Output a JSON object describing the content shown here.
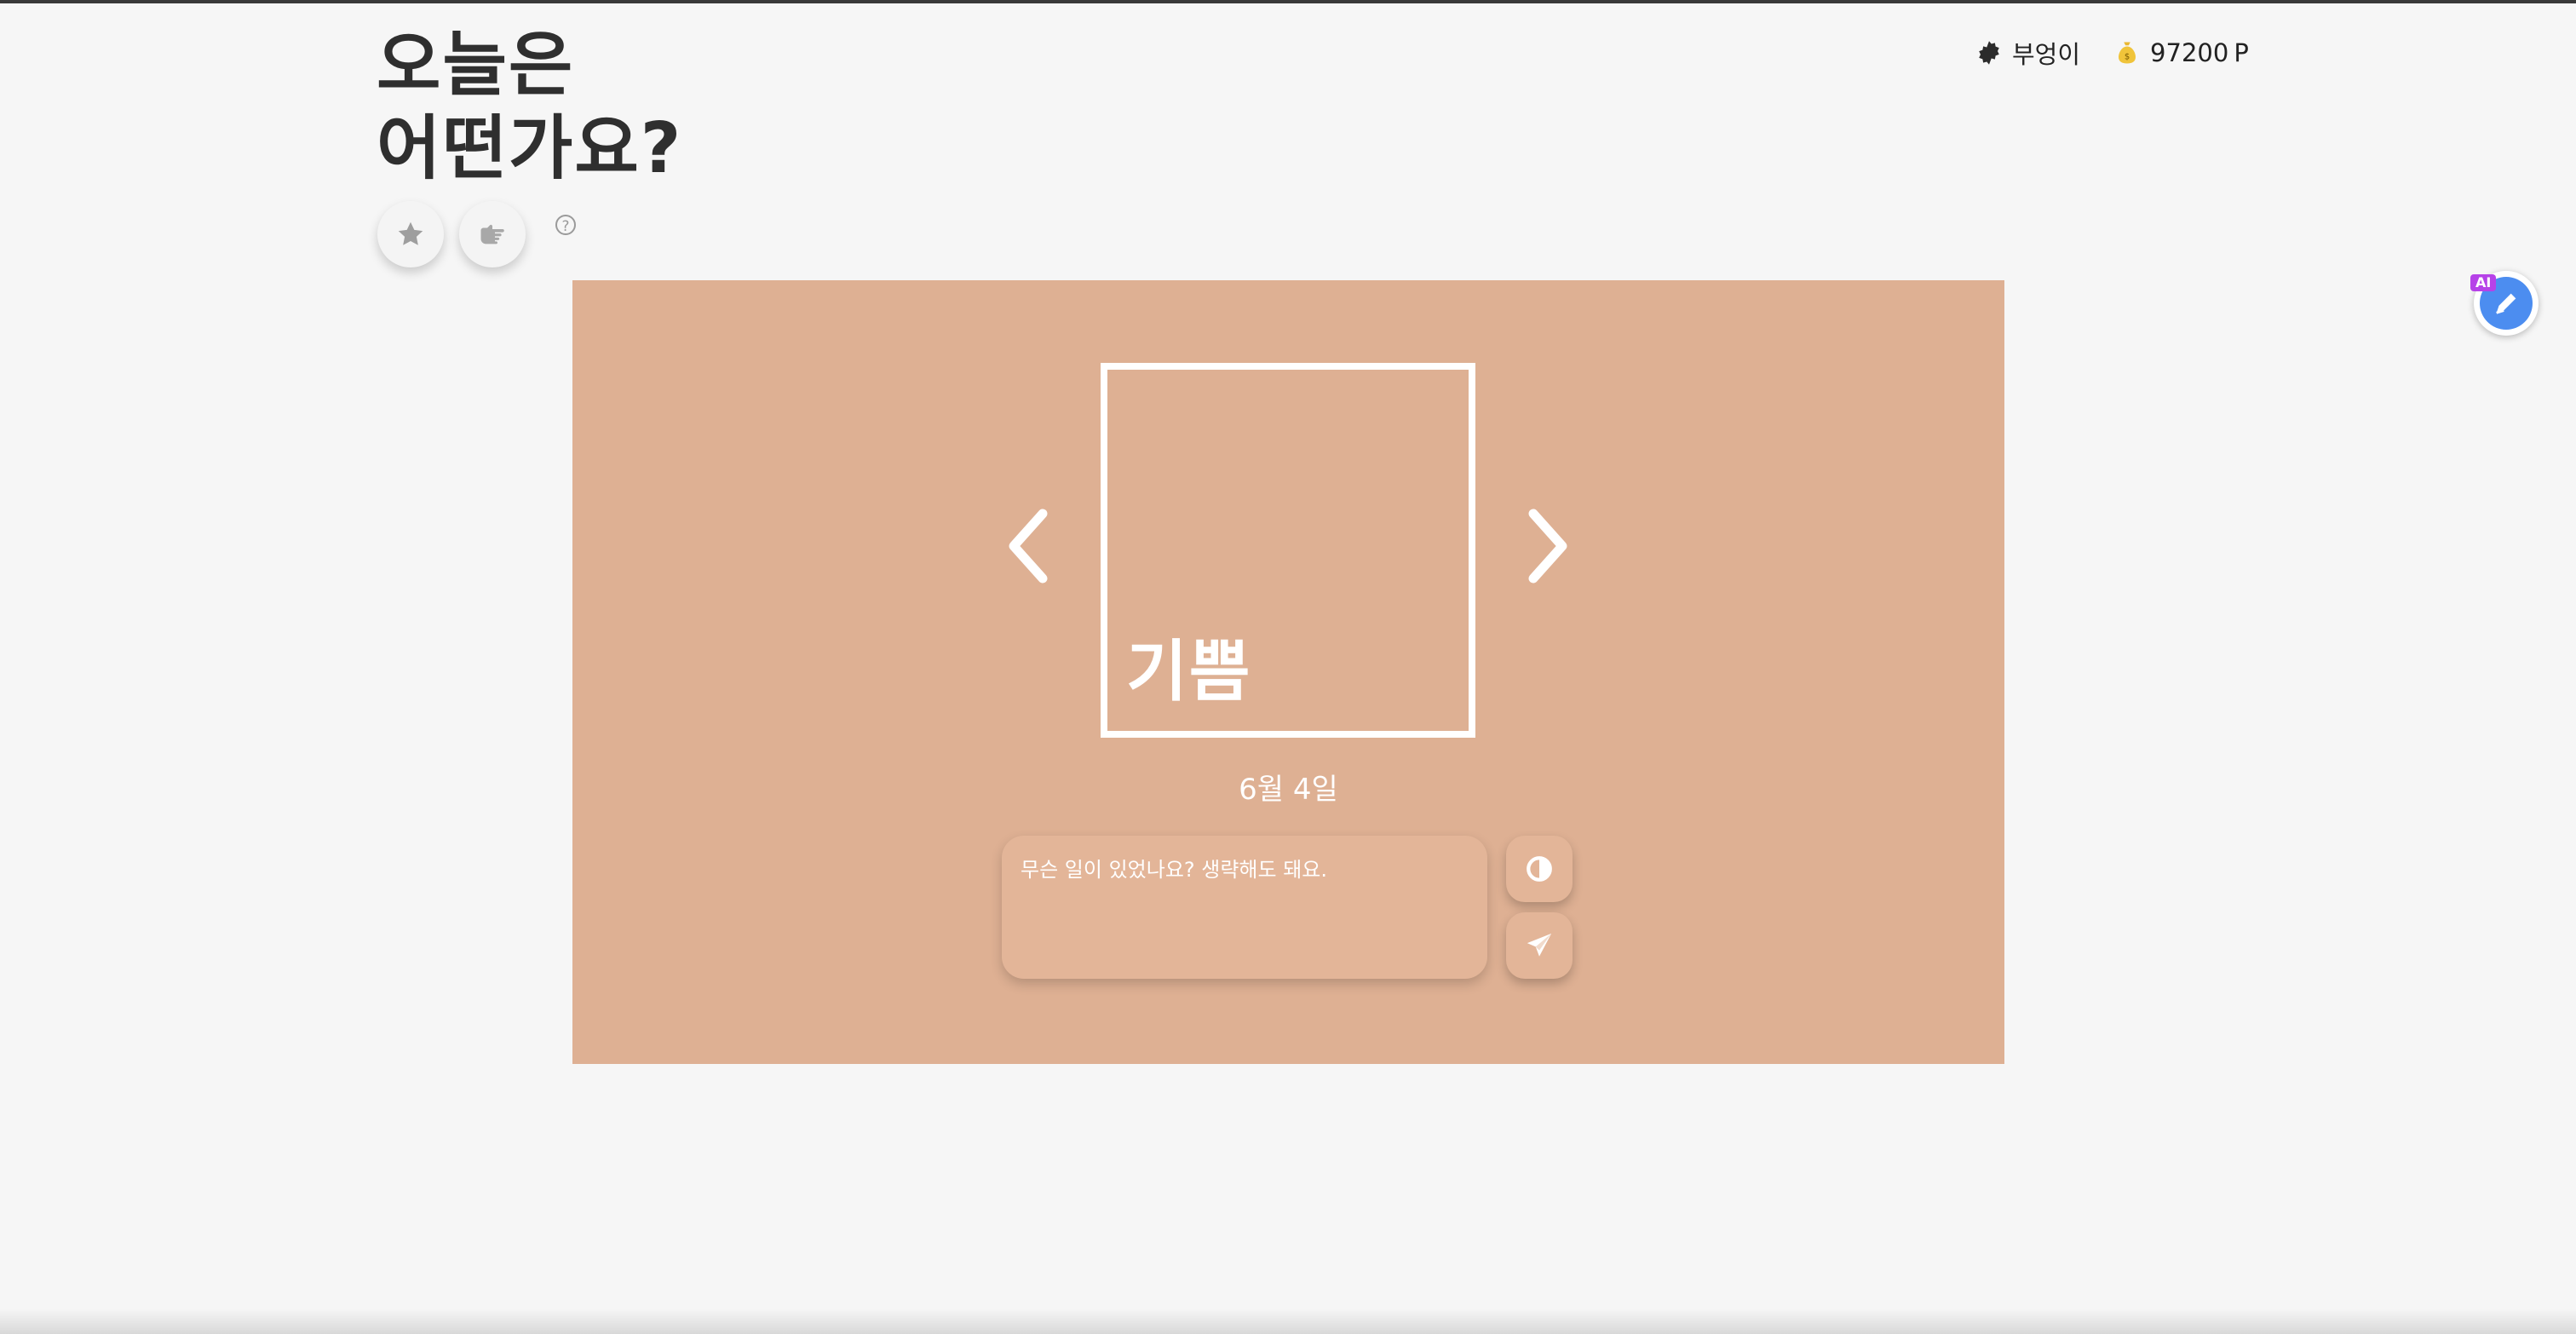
{
  "header": {
    "title_line1": "오늘은",
    "title_line2": "어떤가요?",
    "help_glyph": "?"
  },
  "toolbar": {
    "favorite_icon": "star-icon",
    "filter_icon": "pointing-hand-icon",
    "help_icon": "question-circle-icon"
  },
  "user": {
    "name": "부엉이",
    "avatar_icon": "badge-icon",
    "points": "97200",
    "points_unit": "P",
    "points_icon": "money-bag-icon"
  },
  "mood_card": {
    "emotion": "기쁨",
    "date": "6월 4일",
    "background_color": "#deb093",
    "prev_icon": "chevron-left-icon",
    "next_icon": "chevron-right-icon"
  },
  "note": {
    "placeholder": "무슨 일이 있었나요? 생략해도 돼요.",
    "value": "",
    "theme_icon": "contrast-icon",
    "send_icon": "paper-plane-icon"
  },
  "ai_widget": {
    "badge": "AI",
    "icon": "pen-icon"
  }
}
